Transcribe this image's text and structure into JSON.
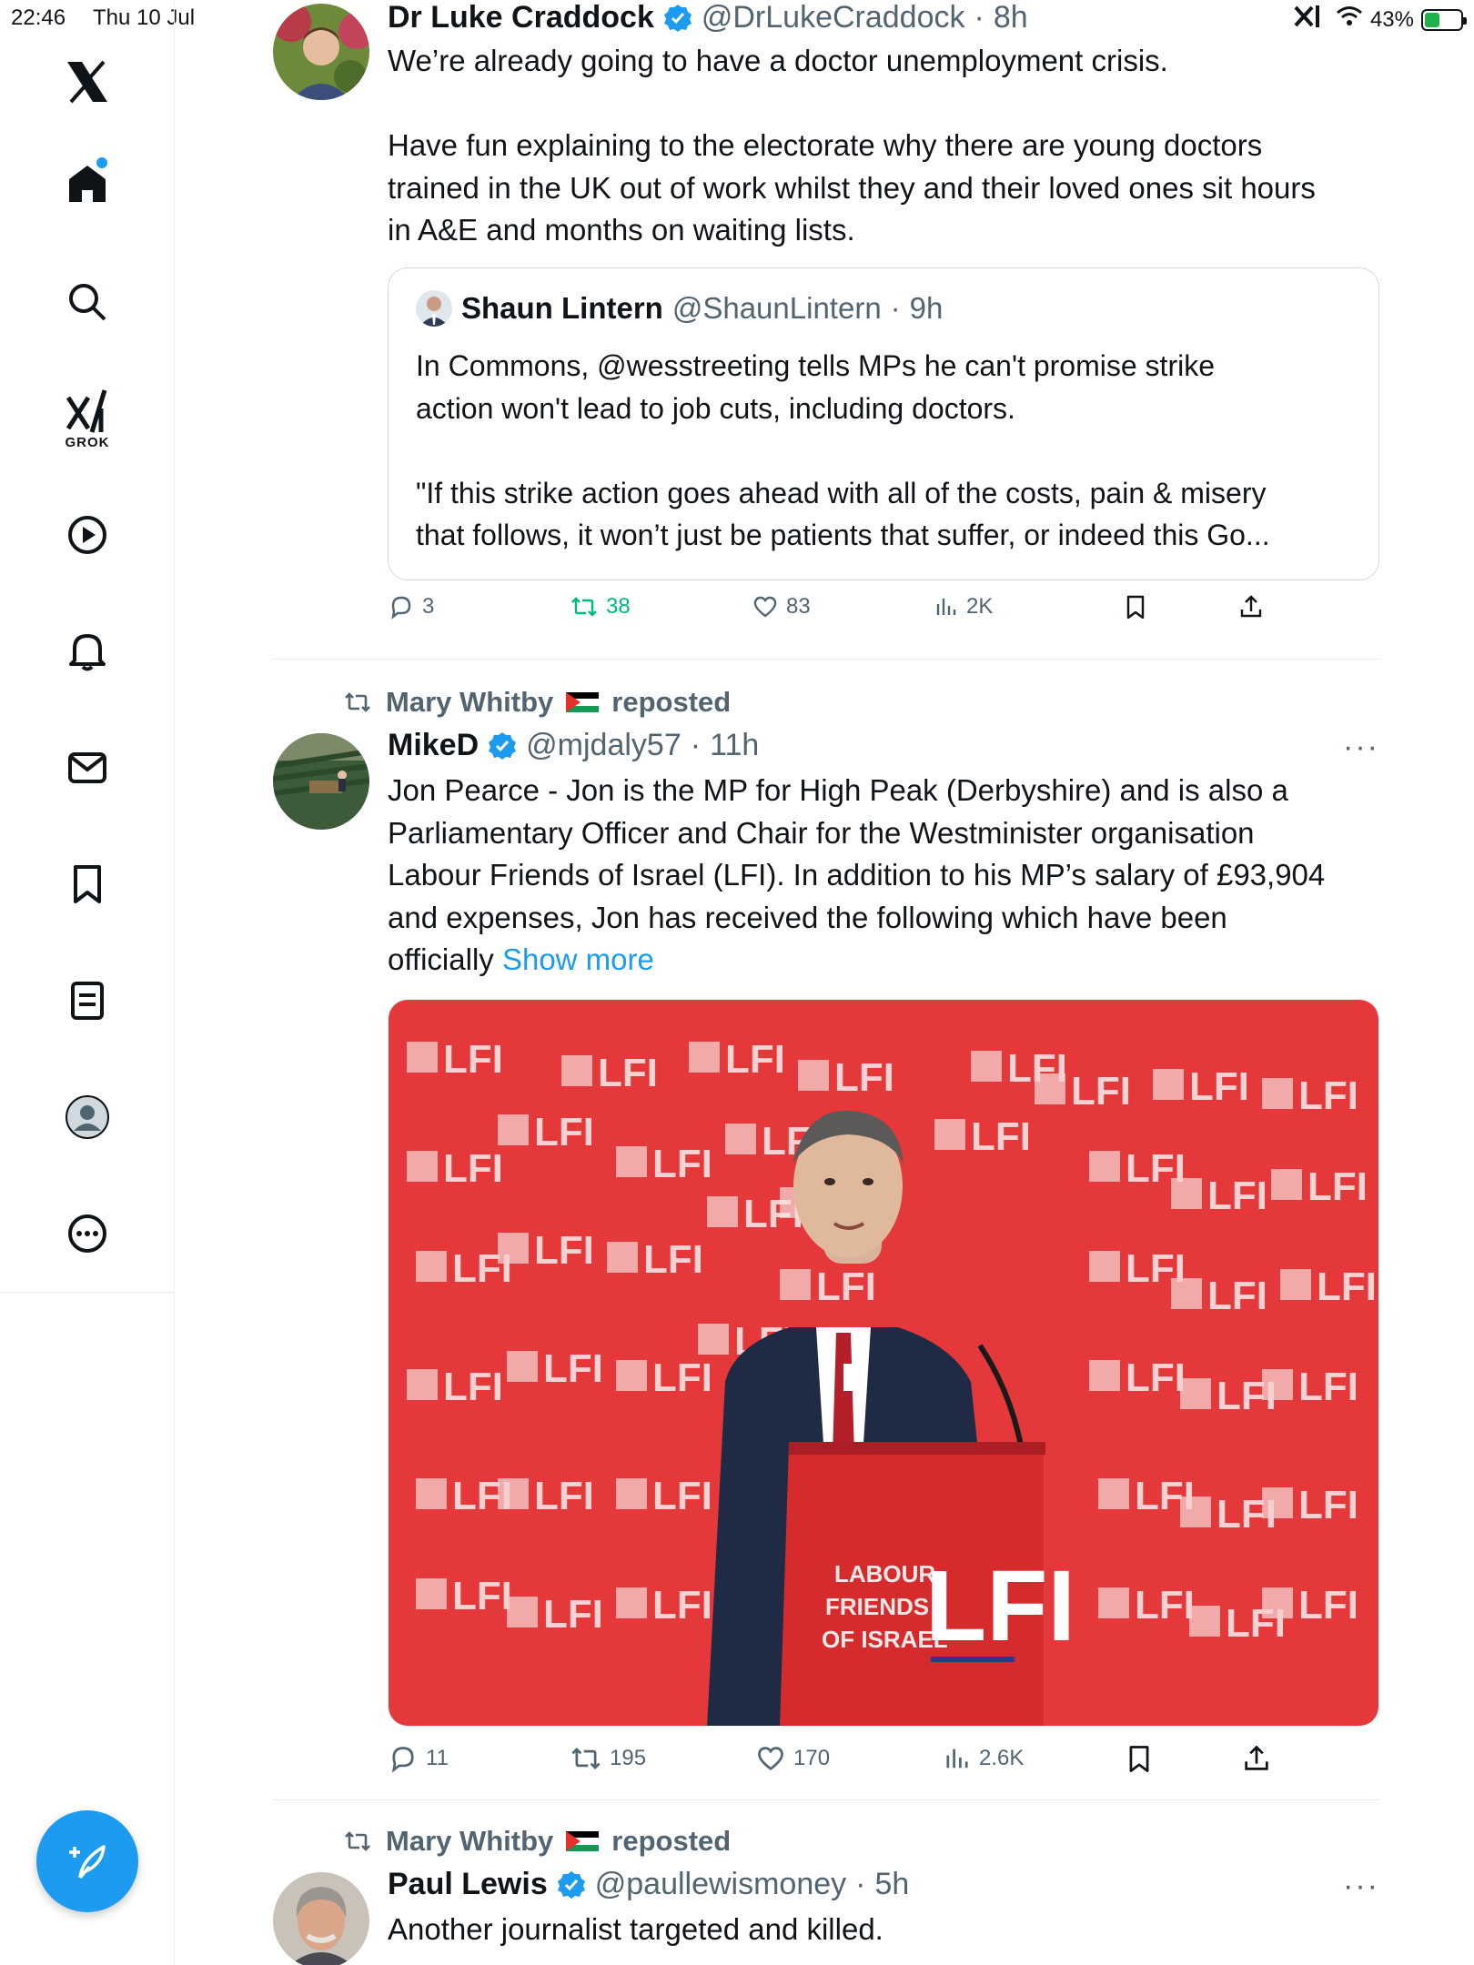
{
  "status_bar": {
    "time": "22:46",
    "date": "Thu 10 Jul",
    "battery": "43%",
    "battery_level": 0.43
  },
  "sidebar": {
    "logo": "x-logo-icon",
    "grok_label": "GROK",
    "items": [
      "home-icon",
      "search-icon",
      "grok-icon",
      "video-icon",
      "notifications-icon",
      "messages-icon",
      "bookmarks-icon",
      "lists-icon",
      "profile-icon",
      "more-icon"
    ],
    "compose": "compose-icon"
  },
  "colors": {
    "accent": "#1d9bf0",
    "muted": "#536471",
    "repost_active": "#00ba7c",
    "text": "#0f1419"
  },
  "posts": [
    {
      "name": "Dr Luke Craddock",
      "handle": "@DrLukeCraddock",
      "time": "8h",
      "verified": true,
      "text_lines": [
        "We’re already going to have a doctor unemployment crisis.",
        "",
        "Have fun explaining to the electorate why there are young doctors",
        "trained in the UK out of work whilst they and their loved ones sit hours",
        "in A&E and months on waiting lists."
      ],
      "quote": {
        "name": "Shaun Lintern",
        "handle": "@ShaunLintern",
        "time": "9h",
        "text_lines": [
          "In Commons, @wesstreeting tells MPs he can't promise strike",
          "action won't lead to job cuts, including doctors.",
          "",
          "\"If this strike action goes ahead with all of the costs, pain & misery",
          "that follows, it won’t just be patients that suffer, or indeed this Go..."
        ]
      },
      "actions": {
        "replies": "3",
        "reposts": "38",
        "likes": "83",
        "views": "2K"
      }
    },
    {
      "reposted_by": "Mary Whitby",
      "reposted_label": "reposted",
      "name": "MikeD",
      "handle": "@mjdaly57",
      "time": "11h",
      "verified": true,
      "text_lines": [
        "Jon Pearce - Jon is the MP for High Peak (Derbyshire) and is also a",
        "Parliamentary Officer and Chair for the Westminister organisation",
        "Labour Friends of Israel (LFI). In addition to his MP’s salary of £93,904",
        "and expenses, Jon has received the following which have been"
      ],
      "last_line": "officially",
      "show_more": "Show more",
      "media": {
        "backdrop_text": "LFI",
        "podium_text": "LFI",
        "podium_small": [
          "LABOUR",
          "FRIENDS",
          "OF ISRAEL"
        ]
      },
      "actions": {
        "replies": "11",
        "reposts": "195",
        "likes": "170",
        "views": "2.6K"
      }
    },
    {
      "reposted_by": "Mary Whitby",
      "reposted_label": "reposted",
      "name": "Paul Lewis",
      "handle": "@paullewismoney",
      "time": "5h",
      "verified": true,
      "text_lines": [
        "Another journalist targeted and killed."
      ]
    }
  ]
}
